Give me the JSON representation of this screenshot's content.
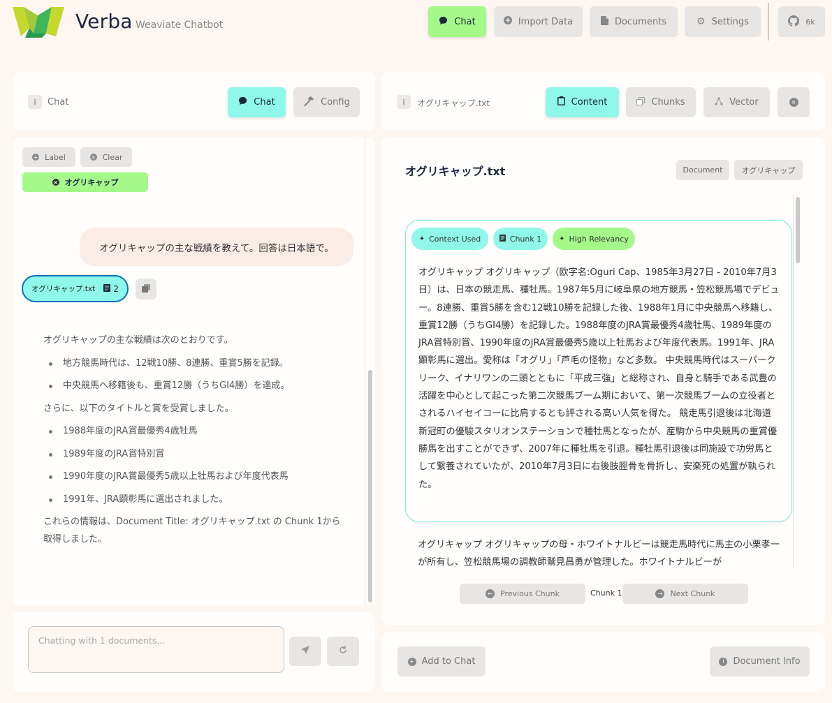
{
  "header": {
    "title": "Verba",
    "subtitle": "Weaviate Chatbot",
    "nav": [
      {
        "label": "Chat"
      },
      {
        "label": "Import Data"
      },
      {
        "label": "Documents"
      },
      {
        "label": "Settings"
      },
      {
        "label": "6k"
      }
    ]
  },
  "chat_panel": {
    "breadcrumb": "Chat",
    "tabs": [
      {
        "label": "Chat"
      },
      {
        "label": "Config"
      }
    ],
    "filters": {
      "label_btn": "Label",
      "clear_btn": "Clear",
      "active_filter": "オグリキャップ"
    },
    "user_message": "オグリキャップの主な戦績を教えて。回答は日本語で。",
    "source_chip": {
      "name": "オグリキャップ.txt",
      "count": "2"
    },
    "answer": {
      "intro": "オグリキャップの主な戦績は次のとおりです。",
      "list1": [
        "地方競馬時代は、12戦10勝、8連勝、重賞5勝を記録。",
        "中央競馬へ移籍後も、重賞12勝（うちGI4勝）を達成。"
      ],
      "middle": "さらに、以下のタイトルと賞を受賞しました。",
      "list2": [
        "1988年度のJRA賞最優秀4歳牡馬",
        "1989年度のJRA賞特別賞",
        "1990年度のJRA賞最優秀5歳以上牡馬および年度代表馬",
        "1991年、JRA顕彰馬に選出されました。"
      ],
      "closing": "これらの情報は、Document Title: オグリキャップ.txt の Chunk 1から取得しました。"
    },
    "input_placeholder": "Chatting with 1 documents..."
  },
  "doc_panel": {
    "breadcrumb": "オグリキャップ.txt",
    "tabs": [
      {
        "label": "Content"
      },
      {
        "label": "Chunks"
      },
      {
        "label": "Vector"
      }
    ],
    "doc_title": "オグリキャップ.txt",
    "tags": [
      "Document",
      "オグリキャップ"
    ],
    "badges": [
      "Context Used",
      "Chunk 1",
      "High Relevancy"
    ],
    "chunk_text": "オグリキャップ オグリキャップ（欧字名:Oguri Cap、1985年3月27日 - 2010年7月3日）は、日本の競走馬、種牡馬。1987年5月に岐阜県の地方競馬・笠松競馬場でデビュー。8連勝、重賞5勝を含む12戦10勝を記録した後、1988年1月に中央競馬へ移籍し、重賞12勝（うちGI4勝）を記録した。1988年度のJRA賞最優秀4歳牡馬、1989年度のJRA賞特別賞、1990年度のJRA賞最優秀5歳以上牡馬および年度代表馬。1991年、JRA顕彰馬に選出。愛称は「オグリ」「芦毛の怪物」など多数。 中央競馬時代はスーパークリーク、イナリワンの二頭とともに「平成三強」と総称され、自身と騎手である武豊の活躍を中心として起こった第二次競馬ブーム期において、第一次競馬ブームの立役者とされるハイセイコーに比肩するとも評される高い人気を得た。 競走馬引退後は北海道新冠町の優駿スタリオンステーションで種牡馬となったが、産駒から中央競馬の重賞優勝馬を出すことができず、2007年に種牡馬を引退。種牡馬引退後は同施設で功労馬として繋養されていたが、2010年7月3日に右後肢脛骨を骨折し、安楽死の処置が執られた。",
    "next_text": "オグリキャップ オグリキャップの母・ホワイトナルビーは競走馬時代に馬主の小栗孝一が所有し、笠松競馬場の調教師鷲見昌勇が管理した。ホワイトナルビーが",
    "prev_btn": "Previous Chunk",
    "chunk_label": "Chunk 1",
    "next_btn": "Next Chunk",
    "add_btn": "Add to Chat",
    "info_btn": "Document Info"
  }
}
